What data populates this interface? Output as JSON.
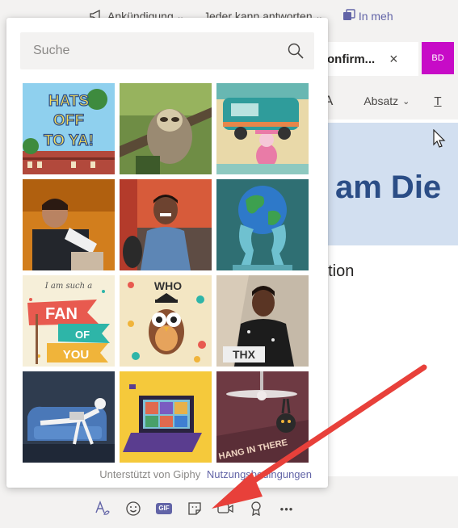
{
  "topbar": {
    "announcement": "Ankündigung",
    "replies": "Jeder kann antworten",
    "channels": "In meh"
  },
  "tab": {
    "title": "onfirm...",
    "avatar_initials": "BD"
  },
  "format": {
    "font_label": "A",
    "paragraph": "Absatz",
    "underline": "T"
  },
  "editor": {
    "heading": "am Die",
    "body": "ation"
  },
  "search": {
    "placeholder": "Suche"
  },
  "gifs": [
    {
      "name": "gif-hats-off",
      "caption": "HATS OFF TO YA!"
    },
    {
      "name": "gif-sloth",
      "caption": ""
    },
    {
      "name": "gif-cartoon-car",
      "caption": ""
    },
    {
      "name": "gif-man-dropping",
      "caption": ""
    },
    {
      "name": "gif-man-laughing",
      "caption": ""
    },
    {
      "name": "gif-globe-atlas",
      "caption": ""
    },
    {
      "name": "gif-fan-of-you",
      "caption": "I am such a FAN OF YOU"
    },
    {
      "name": "gif-owl-who",
      "caption": "WHO"
    },
    {
      "name": "gif-thx",
      "caption": "THX"
    },
    {
      "name": "gif-couch-laptop",
      "caption": ""
    },
    {
      "name": "gif-video-call-laptop",
      "caption": ""
    },
    {
      "name": "gif-hang-in-there",
      "caption": "HANG IN THERE"
    }
  ],
  "footer": {
    "powered": "Unterstützt von Giphy",
    "terms": "Nutzungsbedingungen"
  },
  "toolbar": {
    "gif_label": "GIF",
    "more": "•••"
  },
  "colors": {
    "accent": "#6264a7",
    "arrow": "#e8403a",
    "avatar": "#c70bc7"
  }
}
